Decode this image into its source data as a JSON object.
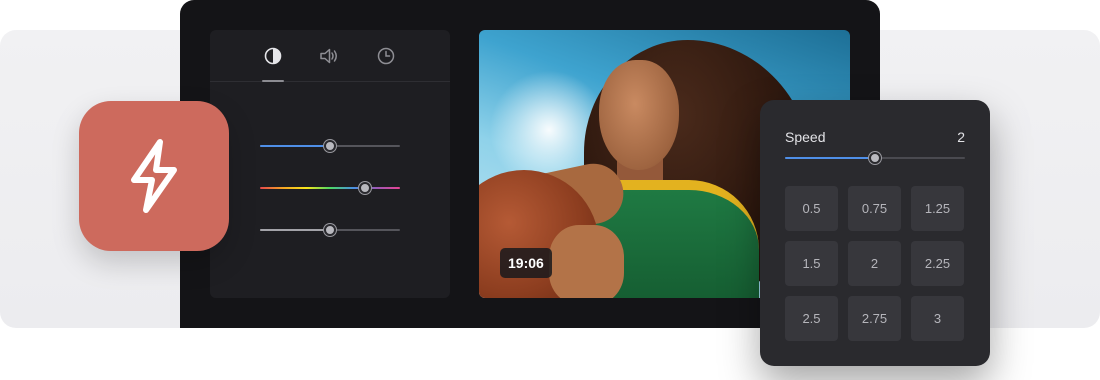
{
  "panel": {
    "tabs": [
      {
        "icon": "contrast-icon",
        "active": true
      },
      {
        "icon": "volume-icon",
        "active": false
      },
      {
        "icon": "clock-icon",
        "active": false
      }
    ],
    "sliders": [
      {
        "name": "blue-slider",
        "value": 0.5
      },
      {
        "name": "hue-slider",
        "value": 0.75
      },
      {
        "name": "gray-slider",
        "value": 0.5
      }
    ]
  },
  "video": {
    "timestamp": "19:06"
  },
  "speed": {
    "label": "Speed",
    "value": "2",
    "slider_value": 0.5,
    "options": [
      "0.5",
      "0.75",
      "1.25",
      "1.5",
      "2",
      "2.25",
      "2.5",
      "2.75",
      "3"
    ]
  },
  "colors": {
    "accent_blue": "#4f8fe8",
    "app_tile": "#cd6a5d",
    "editor_bg": "#141417"
  }
}
